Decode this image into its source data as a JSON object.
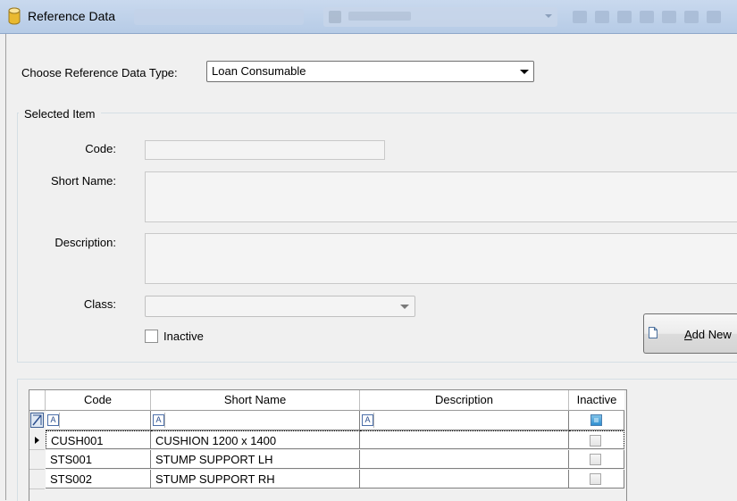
{
  "window": {
    "title": "Reference Data"
  },
  "choose": {
    "label": "Choose Reference Data Type:",
    "selected": "Loan Consumable"
  },
  "selected_item": {
    "group_title": "Selected Item",
    "code_label": "Code:",
    "code_value": "",
    "short_name_label": "Short Name:",
    "short_name_value": "",
    "description_label": "Description:",
    "description_value": "",
    "class_label": "Class:",
    "class_value": "",
    "inactive_label": "Inactive",
    "inactive_checked": false
  },
  "add_new": {
    "label_prefix": "A",
    "label_rest": "dd New"
  },
  "grid": {
    "columns": [
      "Code",
      "Short Name",
      "Description",
      "Inactive"
    ],
    "rows": [
      {
        "code": "CUSH001",
        "short_name": "CUSHION 1200 x 1400",
        "description": "",
        "inactive": false
      },
      {
        "code": "STS001",
        "short_name": "STUMP SUPPORT LH",
        "description": "",
        "inactive": false
      },
      {
        "code": "STS002",
        "short_name": "STUMP SUPPORT RH",
        "description": "",
        "inactive": false
      }
    ],
    "current_row": 0
  },
  "icons": {
    "app": "database-icon",
    "filter": "text-filter-icon",
    "row_indicator": "current-row-arrow-icon",
    "new_doc": "new-document-icon"
  },
  "colors": {
    "titlebar": "#c9d9ee",
    "background": "#f0f0f0",
    "filter_check": "#2f8fd0"
  }
}
